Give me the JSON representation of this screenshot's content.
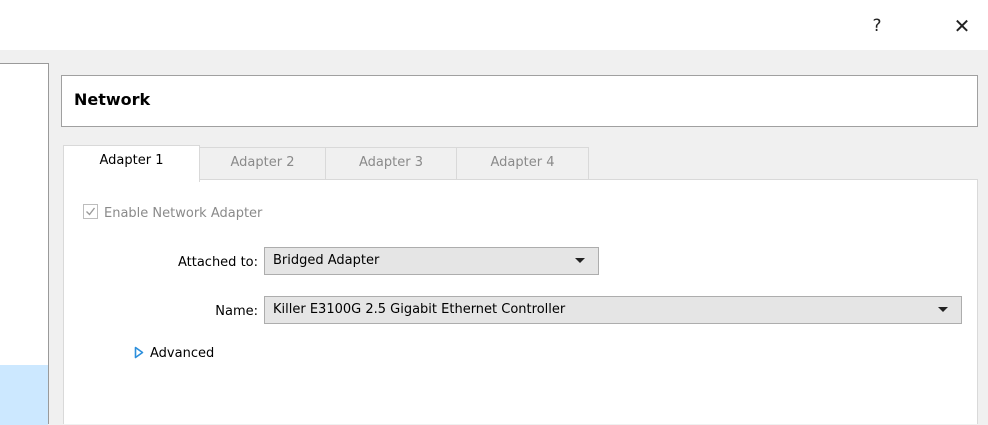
{
  "titlebar": {
    "help_label": "?",
    "close_label": "✕"
  },
  "section": {
    "title": "Network"
  },
  "tabs": [
    {
      "label": "Adapter 1",
      "active": true
    },
    {
      "label": "Adapter 2",
      "active": false
    },
    {
      "label": "Adapter 3",
      "active": false
    },
    {
      "label": "Adapter 4",
      "active": false
    }
  ],
  "adapter": {
    "enable_label": "Enable Network Adapter",
    "enable_checked": true,
    "attached_label": "Attached to:",
    "attached_value": "Bridged Adapter",
    "name_label": "Name:",
    "name_value": "Killer E3100G 2.5 Gigabit Ethernet Controller",
    "advanced_label": "Advanced"
  },
  "icons": {
    "checkbox": "check-icon",
    "advanced": "triangle-right-icon",
    "dropdown": "chevron-down-icon"
  },
  "colors": {
    "accent": "#2c8fdc",
    "selection": "#cce8ff",
    "disabled_text": "#8a8a8a"
  }
}
